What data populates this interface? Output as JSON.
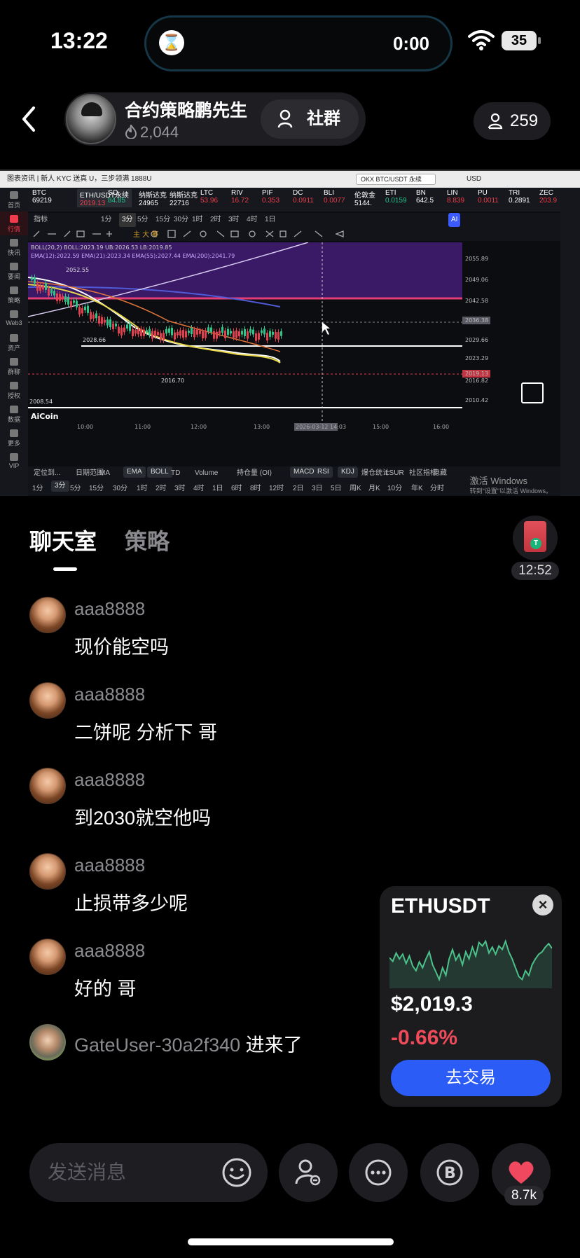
{
  "status": {
    "time": "13:22",
    "island_timer": "0:00",
    "battery": "35"
  },
  "header": {
    "host_name": "合约策略鹏先生",
    "host_fans": "2,044",
    "group_label": "社群",
    "viewers": "259"
  },
  "video": {
    "topbar_text": "图表资讯 | 新人 KYC 送真 U，三步领满 1888U",
    "search_text": "OKX BTC/USDT 永续",
    "currency": "USD",
    "tickers": [
      {
        "sym": "BTC",
        "price": "69219",
        "chg": ""
      },
      {
        "sym": "ETH/USDT永续",
        "price": "2019.13",
        "chg": "1.55%"
      },
      {
        "sym": "SO",
        "price": "84.85",
        "chg": ""
      },
      {
        "sym": "纳斯达克",
        "price": "24965",
        "chg": ""
      },
      {
        "sym": "纳斯达克",
        "price": "22716",
        "chg": ""
      },
      {
        "sym": "LTC",
        "price": "53.96",
        "chg": ""
      },
      {
        "sym": "RIV",
        "price": "16.72",
        "chg": ""
      },
      {
        "sym": "PIF",
        "price": "0.353",
        "chg": ""
      },
      {
        "sym": "DC",
        "price": "0.0911",
        "chg": ""
      },
      {
        "sym": "BLI",
        "price": "0.0077",
        "chg": ""
      },
      {
        "sym": "伦敦金",
        "price": "5144.",
        "chg": ""
      },
      {
        "sym": "ETI",
        "price": "0.0159",
        "chg": ""
      },
      {
        "sym": "BN",
        "price": "642.5",
        "chg": ""
      },
      {
        "sym": "LIN",
        "price": "8.839",
        "chg": ""
      },
      {
        "sym": "PU",
        "price": "0.0011",
        "chg": ""
      },
      {
        "sym": "TRI",
        "price": "0.2891",
        "chg": ""
      },
      {
        "sym": "ZEC",
        "price": "203.9",
        "chg": ""
      }
    ],
    "timeframes_top": [
      "指标",
      "1分",
      "3分",
      "5分",
      "15分",
      "30分",
      "1时",
      "2时",
      "3时",
      "4时",
      "1日"
    ],
    "indicator_boll": "BOLL(20,2)  BOLL:2023.19  UB:2026.53  LB:2019.85",
    "indicator_ema": "EMA(12):2022.59  EMA(21):2023.34  EMA(55):2027.44  EMA(200):2041.79",
    "price_labels": [
      "2055.89",
      "2049.06",
      "2042.58",
      "2036.38",
      "2029.66",
      "2023.29",
      "2019.13",
      "2016.82",
      "2010.42",
      "2008.54"
    ],
    "chart_annotations": [
      "2052.55",
      "2028.66",
      "2016.70",
      "2008.54"
    ],
    "time_axis": [
      "10:00",
      "11:00",
      "12:00",
      "13:00",
      "2026-03-12 14:03",
      "15:00",
      "16:00"
    ],
    "logo": "AiCoin",
    "indicators_bottom": [
      "定位到...",
      "日期范围",
      "MA",
      "EMA",
      "BOLL",
      "TD",
      "Volume",
      "持仓量 (OI)",
      "MACD",
      "RSI",
      "KDJ",
      "爆仓统计",
      "LSUR",
      "社区指标",
      "隐藏"
    ],
    "timeframes_bottom": [
      "1分",
      "3分",
      "5分",
      "15分",
      "30分",
      "1时",
      "2时",
      "3时",
      "4时",
      "1日",
      "6时",
      "8时",
      "12时",
      "2日",
      "3日",
      "5日",
      "周K",
      "月K",
      "10分",
      "年K",
      "分时"
    ],
    "watermark_line1": "激活 Windows",
    "watermark_line2": "转到\"设置\"以激活 Windows。",
    "rail_items": [
      "首页",
      "行情",
      "快讯",
      "要闻",
      "策略",
      "Web3",
      "资产",
      "群聊",
      "授权",
      "数据",
      "更多",
      "VIP"
    ]
  },
  "tabs": {
    "chat": "聊天室",
    "strategy": "策略"
  },
  "countdown": "12:52",
  "messages": [
    {
      "user": "aaa8888",
      "text": "现价能空吗"
    },
    {
      "user": "aaa8888",
      "text": "二饼呢 分析下 哥"
    },
    {
      "user": "aaa8888",
      "text": "到2030就空他吗"
    },
    {
      "user": "aaa8888",
      "text": "止损带多少呢"
    },
    {
      "user": "aaa8888",
      "text": "好的 哥"
    }
  ],
  "join": {
    "user": "GateUser-30a2f340",
    "action": "进来了"
  },
  "market_card": {
    "symbol": "ETHUSDT",
    "price": "$2,019.3",
    "change": "-0.66%",
    "trade_button": "去交易",
    "spark": [
      0.52,
      0.46,
      0.6,
      0.5,
      0.58,
      0.42,
      0.55,
      0.38,
      0.3,
      0.45,
      0.35,
      0.5,
      0.62,
      0.4,
      0.28,
      0.15,
      0.35,
      0.22,
      0.5,
      0.66,
      0.48,
      0.58,
      0.4,
      0.62,
      0.5,
      0.7,
      0.55,
      0.78,
      0.72,
      0.8,
      0.6,
      0.7,
      0.58,
      0.72,
      0.66,
      0.8,
      0.62,
      0.5,
      0.35,
      0.2,
      0.15,
      0.3,
      0.22,
      0.4,
      0.5,
      0.58,
      0.62,
      0.7,
      0.76,
      0.68
    ]
  },
  "composer": {
    "placeholder": "发送消息"
  },
  "likes": "8.7k",
  "colors": {
    "accent_blue": "#2b5cf6",
    "down_red": "#f04b5a",
    "spark_green": "#4cc28b"
  }
}
